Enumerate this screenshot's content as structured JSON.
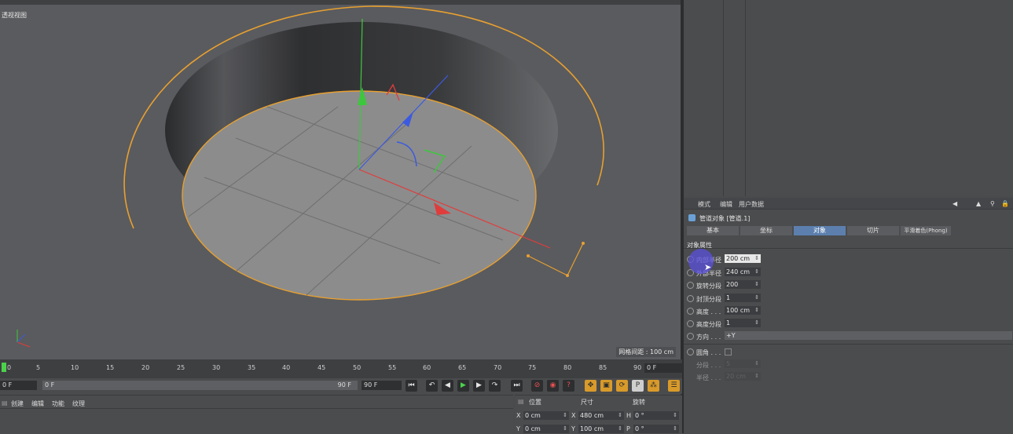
{
  "viewport": {
    "label": "透视视图",
    "grid_spacing": "网格间距 : 100 cm"
  },
  "attributes": {
    "menu": [
      "模式",
      "编辑",
      "用户数据"
    ],
    "object_title": "管道对象 [管道.1]",
    "tabs": [
      "基本",
      "坐标",
      "对象",
      "切片",
      "平滑着色(Phong)"
    ],
    "active_tab": "对象",
    "section_title": "对象属性",
    "params": [
      {
        "label": "内部半径",
        "value": "200 cm"
      },
      {
        "label": "外部半径",
        "value": "240 cm"
      },
      {
        "label": "旋转分段",
        "value": "200"
      },
      {
        "label": "封顶分段",
        "value": "1"
      },
      {
        "label": "高度 . . .",
        "value": "100 cm"
      },
      {
        "label": "高度分段",
        "value": "1"
      },
      {
        "label": "方向 . . .",
        "value": "+Y"
      }
    ],
    "fillet": {
      "label": "圆角 . . .",
      "value": ""
    },
    "fillet_sub": [
      {
        "label": "分段 . . .",
        "value": "5"
      },
      {
        "label": "半径 . . .",
        "value": "20 cm"
      }
    ]
  },
  "timeline": {
    "ticks": [
      "0",
      "5",
      "10",
      "15",
      "20",
      "25",
      "30",
      "35",
      "40",
      "45",
      "50",
      "55",
      "60",
      "65",
      "70",
      "75",
      "80",
      "85",
      "90"
    ],
    "end_frame": "0 F"
  },
  "playbar": {
    "start": "0 F",
    "range_start": "0 F",
    "range_end": "90 F",
    "end": "90 F"
  },
  "bottom_menu": [
    "创建",
    "编辑",
    "功能",
    "纹理"
  ],
  "coords": {
    "headers": [
      "位置",
      "尺寸",
      "旋转"
    ],
    "rows": [
      {
        "axis": "X",
        "pos": "0 cm",
        "size": "480 cm",
        "rot_axis": "H",
        "rot": "0 °"
      },
      {
        "axis": "Y",
        "pos": "0 cm",
        "size": "100 cm",
        "rot_axis": "P",
        "rot": "0 °"
      }
    ]
  },
  "colors": {
    "selection": "#e8a030",
    "x_axis": "#e03c3c",
    "y_axis": "#3cc83c",
    "z_axis": "#3c5ae0",
    "active_tab": "#5c7fae"
  }
}
